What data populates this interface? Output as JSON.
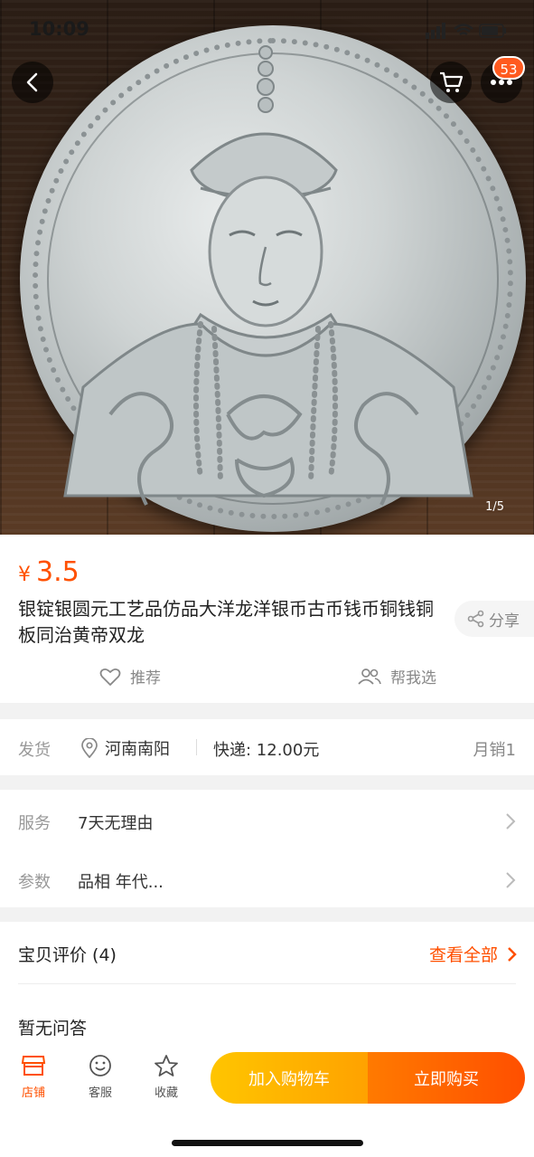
{
  "status": {
    "time": "10:09"
  },
  "header": {
    "cart_badge": "53",
    "image_counter": "1/5"
  },
  "product": {
    "currency": "¥",
    "price": "3.5",
    "title": "银锭银圆元工艺品仿品大洋龙洋银币古币钱币铜钱铜板同治黄帝双龙",
    "share_label": "分享",
    "recommend_label": "推荐",
    "help_pick_label": "帮我选"
  },
  "shipping": {
    "label": "发货",
    "location": "河南南阳",
    "fee": "快递: 12.00元",
    "monthly_sales": "月销1"
  },
  "service": {
    "label": "服务",
    "value": "7天无理由"
  },
  "params": {
    "label": "参数",
    "value": "品相 年代..."
  },
  "reviews": {
    "title": "宝贝评价 (4)",
    "view_all": "查看全部",
    "qa_text": "暂无问答"
  },
  "bottom_bar": {
    "shop_label": "店铺",
    "service_label": "客服",
    "favorite_label": "收藏",
    "add_to_cart": "加入购物车",
    "buy_now": "立即购买"
  },
  "colors": {
    "accent": "#ff5000",
    "cart_button": "#ffb300",
    "buy_button": "#ff5a00"
  }
}
